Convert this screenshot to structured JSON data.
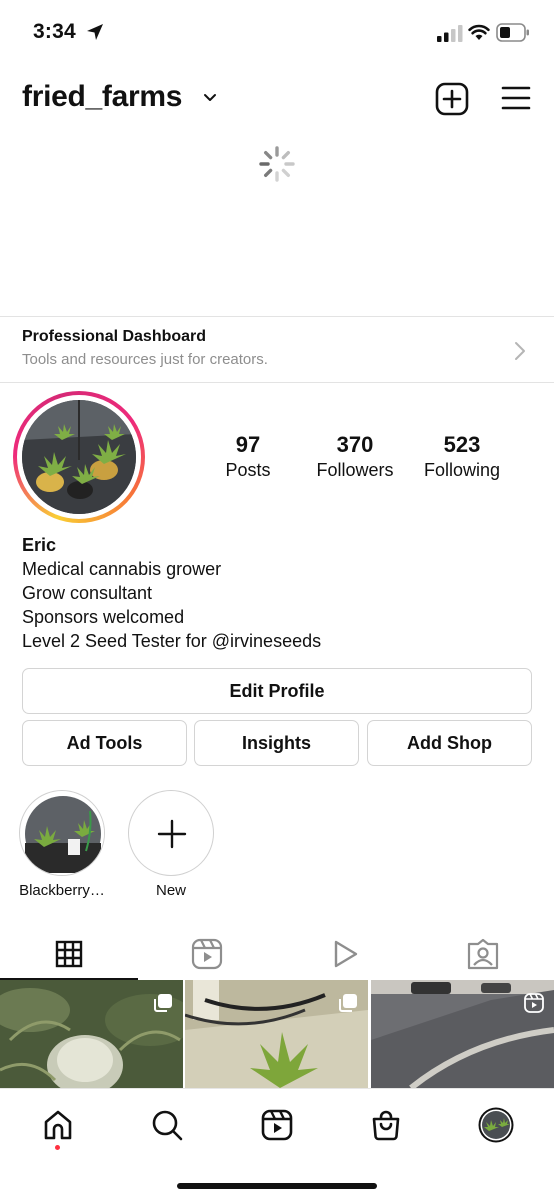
{
  "status_bar": {
    "time": "3:34"
  },
  "header": {
    "username": "fried_farms"
  },
  "dashboard": {
    "title": "Professional Dashboard",
    "subtitle": "Tools and resources just for creators."
  },
  "stats": [
    {
      "value": "97",
      "label": "Posts"
    },
    {
      "value": "370",
      "label": "Followers"
    },
    {
      "value": "523",
      "label": "Following"
    }
  ],
  "bio": {
    "name": "Eric",
    "lines": [
      "Medical cannabis grower",
      "Grow consultant",
      "Sponsors welcomed",
      "Level 2 Seed Tester for @irvineseeds"
    ]
  },
  "buttons": {
    "edit_profile": "Edit Profile",
    "ad_tools": "Ad Tools",
    "insights": "Insights",
    "add_shop": "Add Shop"
  },
  "highlights": [
    {
      "label": "Blackberry…"
    },
    {
      "label": "New"
    }
  ],
  "tabs": [
    {
      "icon": "grid-icon",
      "active": true
    },
    {
      "icon": "reels-icon",
      "active": false
    },
    {
      "icon": "play-icon",
      "active": false
    },
    {
      "icon": "tagged-icon",
      "active": false
    }
  ],
  "nav": [
    "home-icon",
    "search-icon",
    "reels-icon",
    "shop-icon",
    "profile-avatar"
  ],
  "colors": {
    "notification_dot": "#ff3040",
    "muted_text": "#8e8e8e",
    "border": "#d4d4d4"
  }
}
